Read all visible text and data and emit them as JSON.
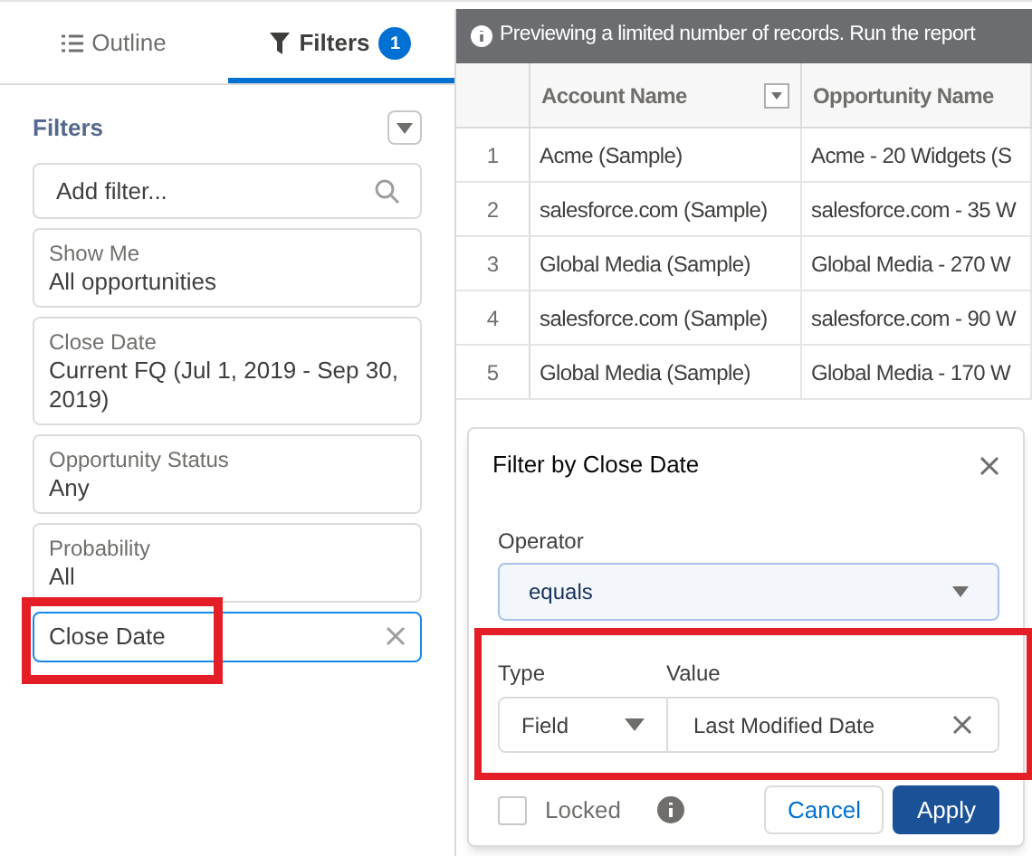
{
  "tabs": [
    {
      "label": "Outline",
      "selected": false
    },
    {
      "label": "Filters",
      "badge": "1",
      "selected": true
    }
  ],
  "filters_panel": {
    "heading": "Filters",
    "search": {
      "placeholder": "Add filter..."
    },
    "filters": [
      {
        "label": "Show Me",
        "value": "All opportunities"
      },
      {
        "label": "Close Date",
        "value": "Current FQ (Jul 1, 2019 - Sep 30, 2019)"
      },
      {
        "label": "Opportunity Status",
        "value": "Any"
      },
      {
        "label": "Probability",
        "value": "All"
      }
    ],
    "new_filter": {
      "value": "Close Date",
      "highlighted": true
    }
  },
  "banner": "Previewing a limited number of records. Run the report",
  "table": {
    "columns": [
      "Account Name",
      "Opportunity Name"
    ],
    "rows": [
      {
        "index": "1",
        "cells": [
          "Acme (Sample)",
          "Acme - 20 Widgets (S"
        ]
      },
      {
        "index": "2",
        "cells": [
          "salesforce.com (Sample)",
          "salesforce.com - 35 W"
        ]
      },
      {
        "index": "3",
        "cells": [
          "Global Media (Sample)",
          "Global Media - 270 W"
        ]
      },
      {
        "index": "4",
        "cells": [
          "salesforce.com (Sample)",
          "salesforce.com - 90 W"
        ]
      },
      {
        "index": "5",
        "cells": [
          "Global Media (Sample)",
          "Global Media - 170 W"
        ]
      }
    ]
  },
  "popover": {
    "title": "Filter by Close Date",
    "operator_label": "Operator",
    "operator": "equals",
    "type_label": "Type",
    "type": "Field",
    "value_label": "Value",
    "value": "Last Modified Date",
    "type_value_highlighted": true,
    "locked": {
      "label": "Locked",
      "checked": false
    },
    "buttons": [
      {
        "label": "Cancel",
        "kind": "neutral"
      },
      {
        "label": "Apply",
        "kind": "brand"
      }
    ]
  }
}
